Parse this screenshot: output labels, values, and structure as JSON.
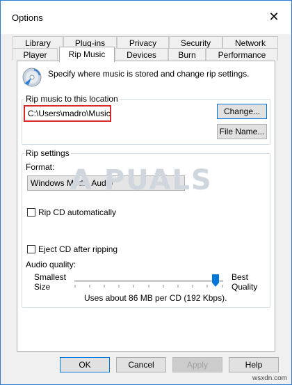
{
  "window": {
    "title": "Options"
  },
  "tabs_row1": [
    "Library",
    "Plug-ins",
    "Privacy",
    "Security",
    "Network"
  ],
  "tabs_row2": [
    "Player",
    "Rip Music",
    "Devices",
    "Burn",
    "Performance"
  ],
  "active_tab": "Rip Music",
  "intro": "Specify where music is stored and change rip settings.",
  "rip_location": {
    "legend": "Rip music to this location",
    "path": "C:\\Users\\madro\\Music",
    "change_label": "Change...",
    "filename_label": "File Name..."
  },
  "rip_settings": {
    "legend": "Rip settings",
    "format_label": "Format:",
    "format_value": "Windows Media Audio",
    "rip_cd_auto": {
      "label": "Rip CD automatically",
      "checked": false
    },
    "eject_cd": {
      "label": "Eject CD after ripping",
      "checked": false
    },
    "audio_quality_label": "Audio quality:",
    "smallest_label": "Smallest",
    "size_label": "Size",
    "best_label": "Best",
    "quality_label": "Quality",
    "usage_text": "Uses about 86 MB per CD (192 Kbps).",
    "slider_level": 0.95
  },
  "footer": {
    "ok_label": "OK",
    "cancel_label": "Cancel",
    "apply_label": "Apply",
    "help_label": "Help"
  },
  "watermark_text": "A  PUALS",
  "site_watermark": "wsxdn.com",
  "colors": {
    "highlight_box": "#d62b2b",
    "focus_border": "#0078d7",
    "thumb": "#0078d7"
  },
  "icons": [
    "cd-icon",
    "close-icon",
    "chevron-down-icon",
    "slider-thumb"
  ]
}
